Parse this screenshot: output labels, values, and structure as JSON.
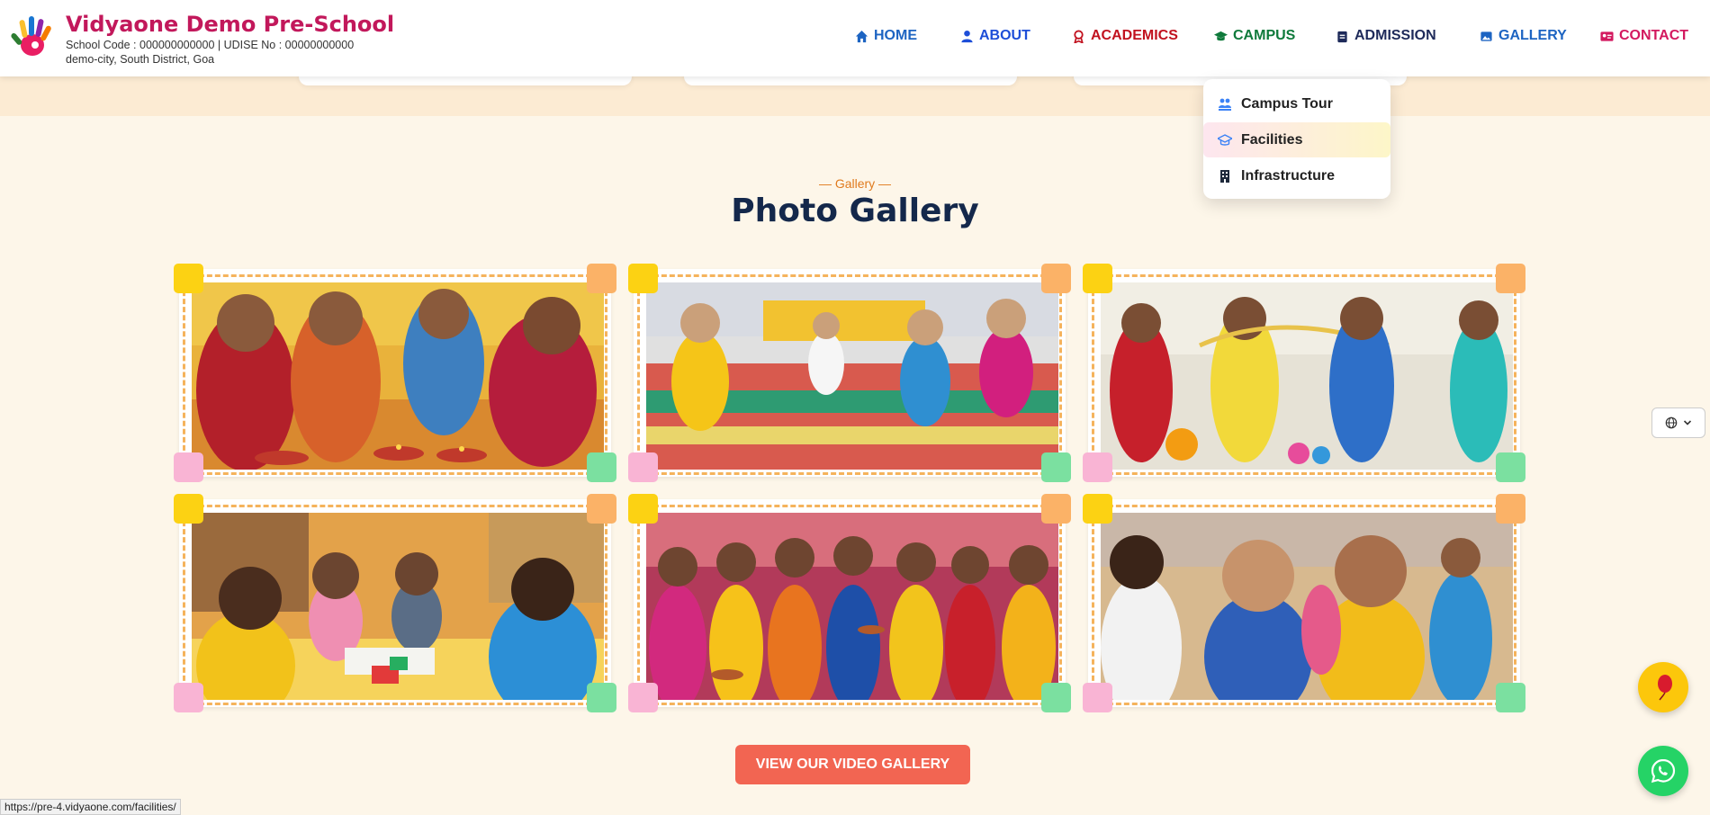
{
  "brand": {
    "title": "Vidyaone Demo Pre-School",
    "codes": "School Code : 000000000000 | UDISE No : 00000000000",
    "address": "demo-city, South District, Goa"
  },
  "nav": [
    {
      "label": "HOME",
      "icon": "home-icon",
      "color": "#1d64c2"
    },
    {
      "label": "ABOUT",
      "icon": "user-icon",
      "color": "#1d4ed8"
    },
    {
      "label": "ACADEMICS",
      "icon": "award-icon",
      "color": "#c1121f"
    },
    {
      "label": "CAMPUS",
      "icon": "graduation-cap-icon",
      "color": "#0f7a3b"
    },
    {
      "label": "ADMISSION",
      "icon": "clipboard-icon",
      "color": "#1e2a5a"
    },
    {
      "label": "GALLERY",
      "icon": "image-icon",
      "color": "#1d64c2"
    },
    {
      "label": "CONTACT",
      "icon": "contact-card-icon",
      "color": "#d3195f"
    }
  ],
  "dropdown": [
    {
      "label": "Campus Tour",
      "icon": "map-users-icon"
    },
    {
      "label": "Facilities",
      "icon": "graduation-cap-icon",
      "active": true
    },
    {
      "label": "Infrastructure",
      "icon": "building-icon"
    }
  ],
  "gallery": {
    "tag": "— Gallery —",
    "title": "Photo Gallery",
    "photos": [
      "children-lighting-diyas",
      "children-running-race",
      "children-science-experiment",
      "children-reading-library",
      "children-holding-diyas-festival",
      "children-playing-outdoors"
    ]
  },
  "video_button": "VIEW OUR VIDEO GALLERY",
  "status_url": "https://pre-4.vidyaone.com/facilities/",
  "colors": {
    "accent": "#f26552",
    "title": "#14284b",
    "brand": "#c2185b"
  }
}
